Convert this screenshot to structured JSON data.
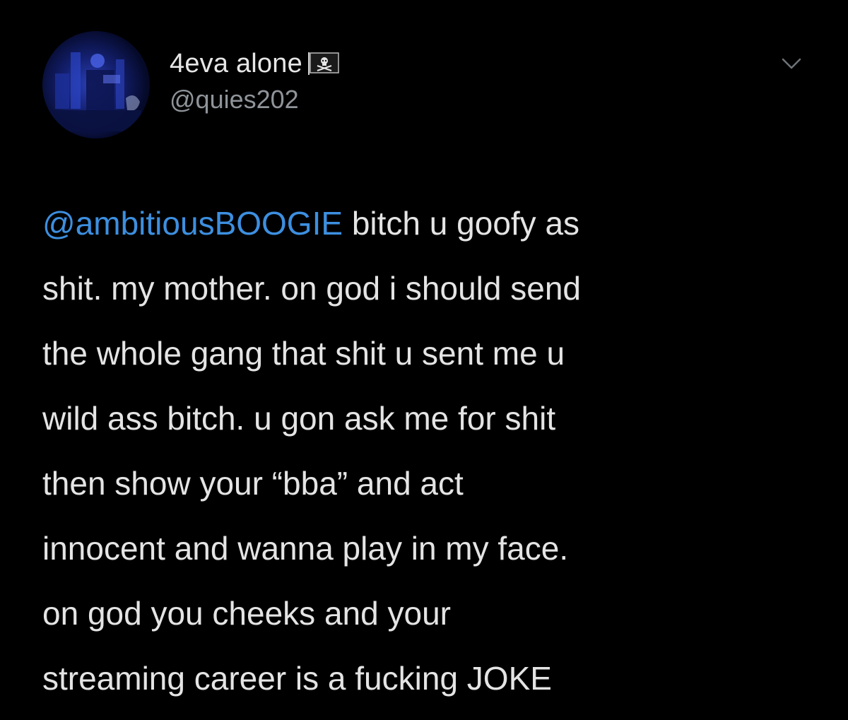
{
  "user": {
    "display_name": "4eva alone",
    "flag_emoji": "pirate-flag",
    "handle": "@quies202"
  },
  "icons": {
    "menu": "chevron-down-icon",
    "flag": "pirate-flag-icon"
  },
  "tweet": {
    "mention": "@ambitiousBOOGIE",
    "line1_rest": " bitch u goofy as",
    "lines": [
      "shit. my mother. on god i should send",
      "the whole gang that shit u sent me u",
      "wild ass bitch. u gon ask me for shit",
      "then show your “bba” and act",
      "innocent and wanna play in my face.",
      "on god you cheeks and your",
      "streaming career is a fucking JOKE"
    ]
  },
  "colors": {
    "background": "#000000",
    "text": "#e4e4e4",
    "handle": "#8f949a",
    "mention": "#3d8fe0"
  }
}
